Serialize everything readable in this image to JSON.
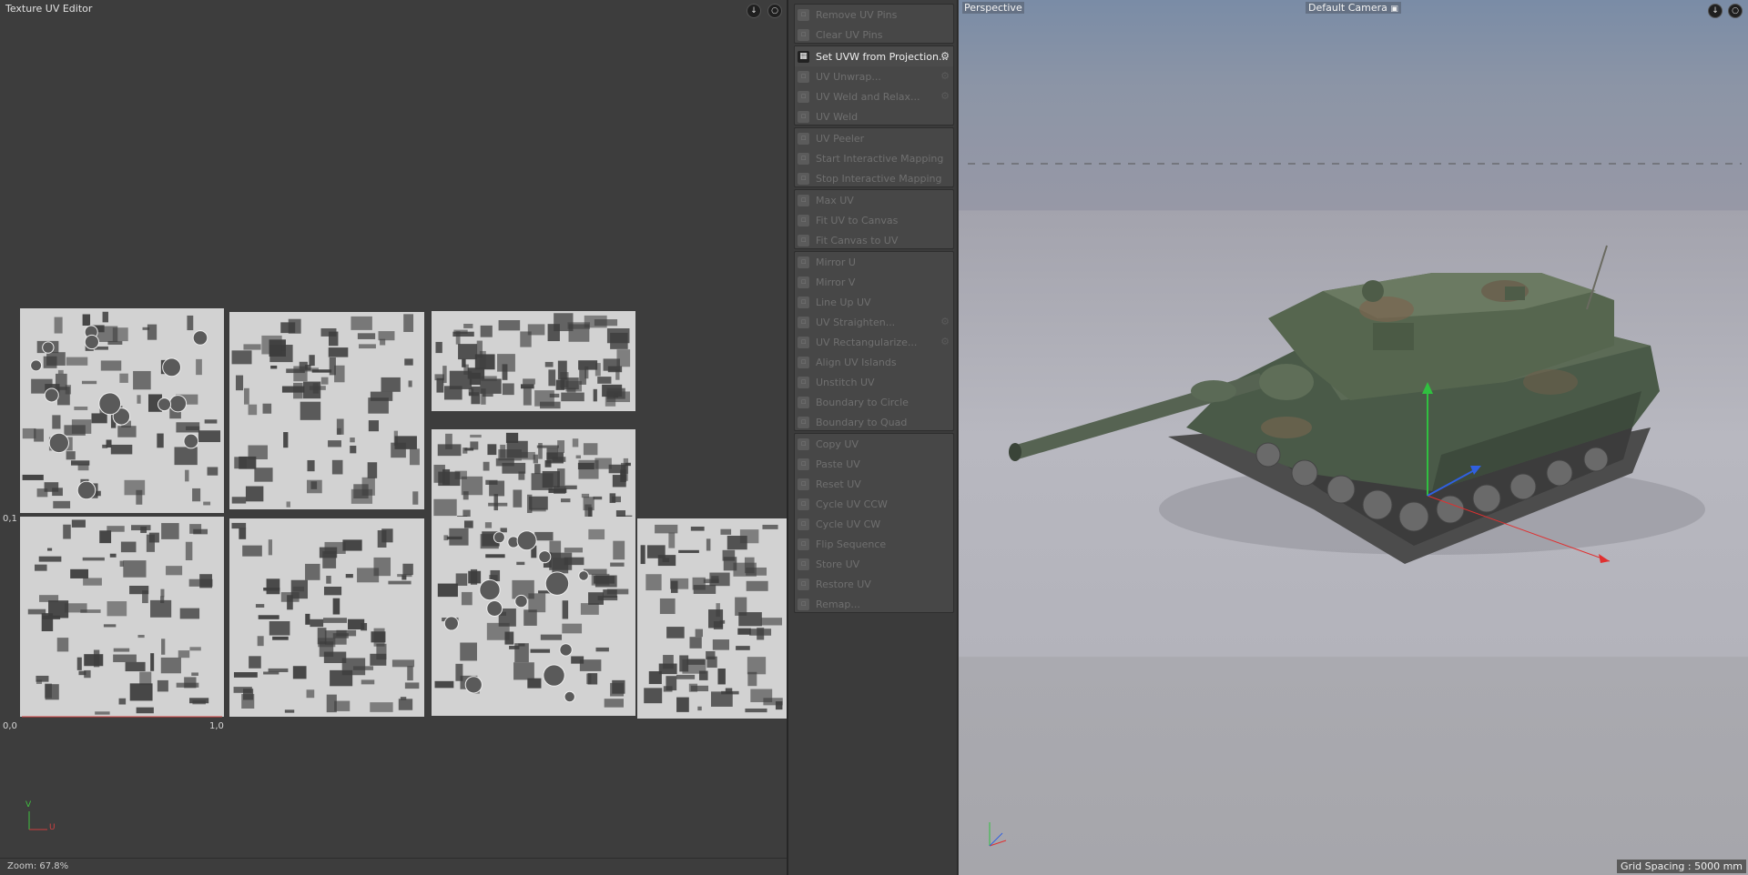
{
  "uv_editor": {
    "title": "Texture UV Editor",
    "header_buttons": [
      "pin-icon",
      "orbit-icon"
    ],
    "origin_label": "0,0",
    "u_max_label": "1,0",
    "v_max_label": "0,1",
    "axis_v": "V",
    "axis_u": "U",
    "zoom": "Zoom: 67.8%"
  },
  "palette": {
    "groups": [
      [
        {
          "label": "Remove UV Pins",
          "enabled": false,
          "gear": false,
          "icon": "pin-icon"
        },
        {
          "label": "Clear UV Pins",
          "enabled": false,
          "gear": false,
          "icon": "pin-clear-icon"
        }
      ],
      [
        {
          "label": "Set UVW from Projection...",
          "enabled": true,
          "gear": true,
          "icon": "checker-icon"
        },
        {
          "label": "UV Unwrap...",
          "enabled": false,
          "gear": true,
          "icon": "unwrap-icon"
        },
        {
          "label": "UV Weld and Relax...",
          "enabled": false,
          "gear": true,
          "icon": "weld-relax-icon"
        },
        {
          "label": "UV Weld",
          "enabled": false,
          "gear": false,
          "icon": "weld-icon"
        }
      ],
      [
        {
          "label": "UV Peeler",
          "enabled": false,
          "gear": false,
          "icon": "peeler-icon"
        },
        {
          "label": "Start Interactive Mapping",
          "enabled": false,
          "gear": false,
          "icon": "interactive-start-icon"
        },
        {
          "label": "Stop Interactive Mapping",
          "enabled": false,
          "gear": false,
          "icon": "interactive-stop-icon"
        }
      ],
      [
        {
          "label": "Max UV",
          "enabled": false,
          "gear": false,
          "icon": "max-uv-icon"
        },
        {
          "label": "Fit UV to Canvas",
          "enabled": false,
          "gear": false,
          "icon": "fit-uv-icon"
        },
        {
          "label": "Fit Canvas to UV",
          "enabled": false,
          "gear": false,
          "icon": "fit-canvas-icon"
        }
      ],
      [
        {
          "label": "Mirror U",
          "enabled": false,
          "gear": false,
          "icon": "mirror-u-icon"
        },
        {
          "label": "Mirror V",
          "enabled": false,
          "gear": false,
          "icon": "mirror-v-icon"
        },
        {
          "label": "Line Up UV",
          "enabled": false,
          "gear": false,
          "icon": "line-up-icon"
        },
        {
          "label": "UV Straighten...",
          "enabled": false,
          "gear": true,
          "icon": "straighten-icon"
        },
        {
          "label": "UV Rectangularize...",
          "enabled": false,
          "gear": true,
          "icon": "rectangularize-icon"
        },
        {
          "label": "Align UV Islands",
          "enabled": false,
          "gear": false,
          "icon": "align-icon"
        },
        {
          "label": "Unstitch UV",
          "enabled": false,
          "gear": false,
          "icon": "unstitch-icon"
        },
        {
          "label": "Boundary to Circle",
          "enabled": false,
          "gear": false,
          "icon": "circle-icon"
        },
        {
          "label": "Boundary to Quad",
          "enabled": false,
          "gear": false,
          "icon": "quad-icon"
        }
      ],
      [
        {
          "label": "Copy UV",
          "enabled": false,
          "gear": false,
          "icon": "copy-icon"
        },
        {
          "label": "Paste UV",
          "enabled": false,
          "gear": false,
          "icon": "paste-icon"
        },
        {
          "label": "Reset UV",
          "enabled": false,
          "gear": false,
          "icon": "reset-icon"
        },
        {
          "label": "Cycle UV CCW",
          "enabled": false,
          "gear": false,
          "icon": "cycle-ccw-icon"
        },
        {
          "label": "Cycle UV CW",
          "enabled": false,
          "gear": false,
          "icon": "cycle-cw-icon"
        },
        {
          "label": "Flip Sequence",
          "enabled": false,
          "gear": false,
          "icon": "flip-icon"
        },
        {
          "label": "Store UV",
          "enabled": false,
          "gear": false,
          "icon": "store-icon"
        },
        {
          "label": "Restore UV",
          "enabled": false,
          "gear": false,
          "icon": "restore-icon"
        },
        {
          "label": "Remap...",
          "enabled": false,
          "gear": false,
          "icon": "remap-icon"
        }
      ]
    ]
  },
  "viewport": {
    "name": "Perspective",
    "camera": "Default Camera",
    "camera_icon": "camera-icon",
    "grid_spacing": "Grid Spacing : 5000 mm",
    "header_buttons": [
      "pin-icon",
      "orbit-icon"
    ],
    "colors": {
      "x_axis": "#e03030",
      "y_axis": "#30c040",
      "z_axis": "#3060e0",
      "tank_body": "#4a5a48"
    }
  }
}
